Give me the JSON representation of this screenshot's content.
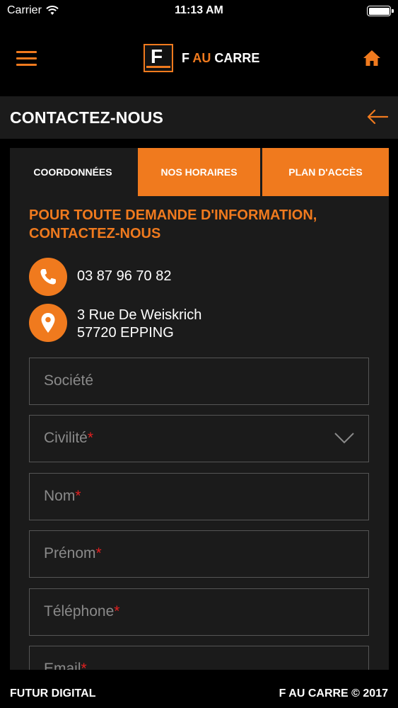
{
  "status_bar": {
    "carrier": "Carrier",
    "time": "11:13 AM"
  },
  "header": {
    "brand_prefix": "F ",
    "brand_accent": "AU",
    "brand_suffix": " CARRE",
    "logo_letter": "F"
  },
  "title_bar": {
    "title": "CONTACTEZ-NOUS"
  },
  "tabs": [
    {
      "label": "COORDONNÉES",
      "active": true
    },
    {
      "label": "NOS HORAIRES",
      "active": false
    },
    {
      "label": "PLAN D'ACCÈS",
      "active": false
    }
  ],
  "contact": {
    "intro_line1": "POUR TOUTE DEMANDE D'INFORMATION,",
    "intro_line2": "CONTACTEZ-NOUS",
    "phone": "03 87 96 70 82",
    "address_line1": "3 Rue De Weiskrich",
    "address_line2": "57720 EPPING"
  },
  "form": {
    "fields": [
      {
        "placeholder": "Société",
        "required": ""
      },
      {
        "placeholder": "Civilité",
        "required": "*"
      },
      {
        "placeholder": "Nom",
        "required": "*"
      },
      {
        "placeholder": "Prénom",
        "required": "*"
      },
      {
        "placeholder": "Téléphone",
        "required": "*"
      },
      {
        "placeholder": "Email",
        "required": "*"
      }
    ]
  },
  "footer": {
    "left": "FUTUR DIGITAL",
    "right": "F AU CARRE © 2017"
  },
  "colors": {
    "accent": "#f07a1e",
    "background": "#000000",
    "panel": "#1b1b1b",
    "required": "#e02020"
  }
}
